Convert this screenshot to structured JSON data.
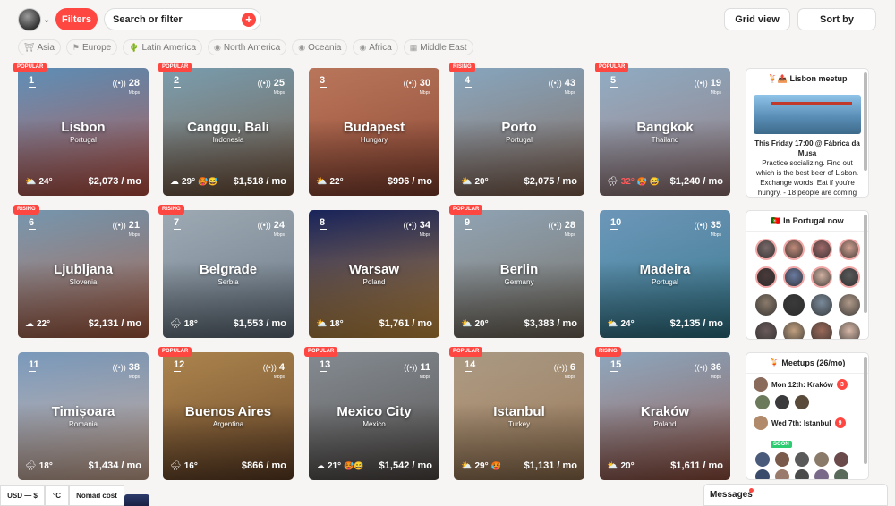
{
  "header": {
    "filters_label": "Filters",
    "search_placeholder": "Search or filter",
    "grid_view_label": "Grid view",
    "sort_by_label": "Sort by"
  },
  "regions": [
    {
      "label": "Asia",
      "icon": "torii-icon"
    },
    {
      "label": "Europe",
      "icon": "flag-icon"
    },
    {
      "label": "Latin America",
      "icon": "cactus-icon"
    },
    {
      "label": "North America",
      "icon": "globe-icon"
    },
    {
      "label": "Oceania",
      "icon": "globe-icon"
    },
    {
      "label": "Africa",
      "icon": "globe-icon"
    },
    {
      "label": "Middle East",
      "icon": "building-icon"
    }
  ],
  "cities": [
    {
      "rank": "1",
      "badge": "POPULAR",
      "city": "Lisbon",
      "country": "Portugal",
      "wifi": "28",
      "wifi_unit": "Mbps",
      "temp": "24°",
      "cost": "$2,073 / mo",
      "weather": "⛅",
      "emoji": "",
      "colors": [
        "#6fa7d6",
        "#b04a3a"
      ]
    },
    {
      "rank": "2",
      "badge": "POPULAR",
      "city": "Canggu, Bali",
      "country": "Indonesia",
      "wifi": "25",
      "wifi_unit": "Mbps",
      "temp": "29°",
      "cost": "$1,518 / mo",
      "weather": "☁",
      "emoji": "🥵😅",
      "colors": [
        "#8fb8cc",
        "#6b4a32"
      ]
    },
    {
      "rank": "3",
      "badge": "",
      "city": "Budapest",
      "country": "Hungary",
      "wifi": "30",
      "wifi_unit": "Mbps",
      "temp": "22°",
      "cost": "$996 / mo",
      "weather": "⛅",
      "emoji": "",
      "colors": [
        "#d98a6a",
        "#7a3a2a"
      ]
    },
    {
      "rank": "4",
      "badge": "RISING",
      "city": "Porto",
      "country": "Portugal",
      "wifi": "43",
      "wifi_unit": "Mbps",
      "temp": "20°",
      "cost": "$2,075 / mo",
      "weather": "⛅",
      "emoji": "",
      "colors": [
        "#9fc2de",
        "#7a5a48"
      ]
    },
    {
      "rank": "5",
      "badge": "POPULAR",
      "city": "Bangkok",
      "country": "Thailand",
      "wifi": "19",
      "wifi_unit": "Mbps",
      "temp": "32°",
      "cost": "$1,240 / mo",
      "weather": "🌧",
      "emoji": "🥵 😅",
      "hot": true,
      "colors": [
        "#a9c9e4",
        "#8a6a6a"
      ]
    },
    {
      "rank": "6",
      "badge": "RISING",
      "city": "Ljubljana",
      "country": "Slovenia",
      "wifi": "21",
      "wifi_unit": "Mbps",
      "temp": "22°",
      "cost": "$2,131 / mo",
      "weather": "☁",
      "emoji": "",
      "colors": [
        "#8bb0cc",
        "#a2563a"
      ]
    },
    {
      "rank": "7",
      "badge": "RISING",
      "city": "Belgrade",
      "country": "Serbia",
      "wifi": "24",
      "wifi_unit": "Mbps",
      "temp": "18°",
      "cost": "$1,553 / mo",
      "weather": "🌧",
      "emoji": "",
      "colors": [
        "#b8c6d2",
        "#5a6672"
      ]
    },
    {
      "rank": "8",
      "badge": "",
      "city": "Warsaw",
      "country": "Poland",
      "wifi": "34",
      "wifi_unit": "Mbps",
      "temp": "18°",
      "cost": "$1,761 / mo",
      "weather": "⛅",
      "emoji": "",
      "colors": [
        "#1d2a6a",
        "#c08a3a"
      ]
    },
    {
      "rank": "9",
      "badge": "POPULAR",
      "city": "Berlin",
      "country": "Germany",
      "wifi": "28",
      "wifi_unit": "Mbps",
      "temp": "20°",
      "cost": "$3,383 / mo",
      "weather": "⛅",
      "emoji": "",
      "colors": [
        "#a9bfd2",
        "#6a6052"
      ]
    },
    {
      "rank": "10",
      "badge": "",
      "city": "Madeira",
      "country": "Portugal",
      "wifi": "35",
      "wifi_unit": "Mbps",
      "temp": "24°",
      "cost": "$2,135 / mo",
      "weather": "⛅",
      "emoji": "",
      "colors": [
        "#7fb0d8",
        "#2a6a7a"
      ]
    },
    {
      "rank": "11",
      "badge": "",
      "city": "Timișoara",
      "country": "Romania",
      "wifi": "38",
      "wifi_unit": "Mbps",
      "temp": "18°",
      "cost": "$1,434 / mo",
      "weather": "🌧",
      "emoji": "",
      "colors": [
        "#8fb4dc",
        "#c4a08a"
      ]
    },
    {
      "rank": "12",
      "badge": "POPULAR",
      "city": "Buenos Aires",
      "country": "Argentina",
      "wifi": "4",
      "wifi_unit": "Mbps",
      "temp": "16°",
      "cost": "$866 / mo",
      "weather": "🌧",
      "emoji": "",
      "colors": [
        "#c89a5a",
        "#5a3a22"
      ]
    },
    {
      "rank": "13",
      "badge": "POPULAR",
      "city": "Mexico City",
      "country": "Mexico",
      "wifi": "11",
      "wifi_unit": "Mbps",
      "temp": "21°",
      "cost": "$1,542 / mo",
      "weather": "☁",
      "emoji": "🥵😅",
      "colors": [
        "#9aa2aa",
        "#4a4440"
      ]
    },
    {
      "rank": "14",
      "badge": "POPULAR",
      "city": "Istanbul",
      "country": "Turkey",
      "wifi": "6",
      "wifi_unit": "Mbps",
      "temp": "29°",
      "cost": "$1,131 / mo",
      "weather": "⛅",
      "emoji": "🥵",
      "colors": [
        "#c9b49a",
        "#8a6a4a"
      ]
    },
    {
      "rank": "15",
      "badge": "RISING",
      "city": "Kraków",
      "country": "Poland",
      "wifi": "36",
      "wifi_unit": "Mbps",
      "temp": "20°",
      "cost": "$1,611 / mo",
      "weather": "⛅",
      "emoji": "",
      "colors": [
        "#a6c3de",
        "#8a4a3a"
      ]
    }
  ],
  "sidebar": {
    "meetup_title": "🍹📤 Lisbon meetup",
    "meetup_when": "This Friday 17:00 @ Fábrica da Musa",
    "meetup_desc": "Practice socializing. Find out which is the best beer of Lisbon. Exchange words. Eat if you're hungry. - 18 people are coming",
    "in_country_title": "🇵🇹 In Portugal now",
    "meetups_title": "🍹 Meetups (26/mo)",
    "meetup1_label": "Mon 12th: Kraków",
    "meetup1_count": "3",
    "meetup2_label": "Wed 7th: Istanbul",
    "meetup2_count": "9",
    "soon_label": "SOON"
  },
  "footer": {
    "currency": "USD — $",
    "units": "°C",
    "cost_mode": "Nomad cost",
    "messages": "Messages"
  }
}
